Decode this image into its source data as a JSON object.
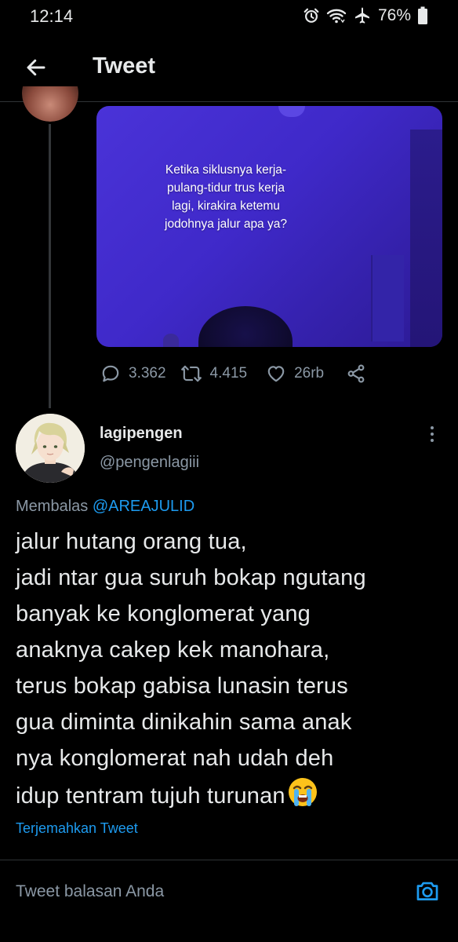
{
  "status_bar": {
    "time": "12:14",
    "battery": "76%",
    "icons": [
      "alarm-icon",
      "wifi-icon",
      "airplane-icon",
      "battery-icon"
    ]
  },
  "header": {
    "title": "Tweet",
    "back_icon": "arrow-left-icon"
  },
  "previous_tweet": {
    "media_caption": "Ketika siklusnya kerja-\npulang-tidur trus kerja\nlagi, kirakira ketemu\njodohnya jalur apa ya?",
    "stats": {
      "replies": "3.362",
      "retweets": "4.415",
      "likes": "26rb"
    }
  },
  "tweet": {
    "author_name": "lagipengen",
    "author_handle": "@pengenlagiii",
    "replying_label": "Membalas",
    "replying_to": "@AREAJULID",
    "text_lines": [
      "jalur hutang orang tua,",
      "jadi ntar gua suruh bokap ngutang",
      "banyak ke konglomerat yang",
      "anaknya cakep kek manohara,",
      "terus bokap gabisa lunasin terus",
      "gua diminta dinikahin sama anak",
      "nya konglomerat nah udah deh",
      "idup tentram tujuh turunan"
    ],
    "translate_label": "Terjemahkan Tweet"
  },
  "reply_bar": {
    "placeholder": "Tweet balasan Anda"
  },
  "colors": {
    "background": "#000000",
    "text": "#e7e9ea",
    "muted": "#8b98a5",
    "link": "#1d9bf0",
    "divider": "#2f3336"
  }
}
